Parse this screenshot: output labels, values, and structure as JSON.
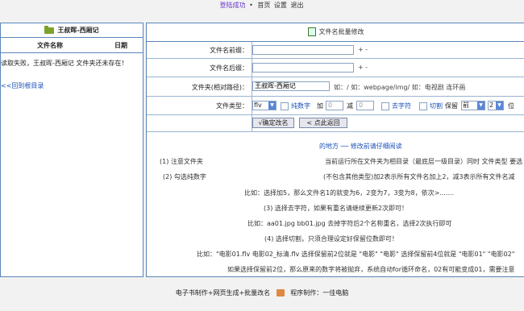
{
  "nav": {
    "login_status": "登陆成功",
    "dot": "•",
    "home": "首页",
    "settings": "设置",
    "logout": "退出"
  },
  "left": {
    "folder_title": "王叔晖-西厢记",
    "col_name": "文件名称",
    "col_date": "日期",
    "error_msg": "读取失败，王叔晖-西厢记 文件夹还未存在！",
    "back_link": "<<回到根目录"
  },
  "right": {
    "title": "文件名批量修改",
    "prefix_label": "文件名前缀：",
    "prefix_value": "",
    "prefix_hint": "+ -",
    "suffix_label": "文件名后缀：",
    "suffix_value": "",
    "suffix_hint": "+ -",
    "folder_label": "文件夹(相对路径)：",
    "folder_value": "王叔晖-西厢记",
    "folder_hint": "如：/ 如：webpage/img/ 如：电视剧 连环画",
    "type_label": "文件类型：",
    "type_value": "flv",
    "pure_number_label": "纯数字",
    "add_label": "加",
    "add_value": "0",
    "sub_label": "减",
    "sub_value": "0",
    "remove_chars_label": "去字符",
    "cut_label": "切割",
    "keep_label": "保留",
    "keep_select": "前",
    "keep_value": "2",
    "bits_label": "位",
    "confirm_button": "√确定改名",
    "back_button": "< 点此返回"
  },
  "info": {
    "heading_tail": "的地方 ── 修改前请仔细阅读",
    "line1": "(1) 注意文件夹",
    "line1b": "当前运行所在文件夹为相目录（最底层一级目录）同时 文件类型 要选",
    "line2": "(2) 勾选纯数字",
    "line2b": "(不包含其他类型)加2表示所有文件名加上2，减3表示所有文件名减",
    "line3": "比如：选择加5，那么文件名1的就变为6，2变为7，3变为8，依次>.......",
    "line4": "(3) 选择去字符，如果有重名请继续更新2次即可！",
    "line5": "比如：aa01.jpg bb01.jpg 去掉字符后2个名称重名，选择2次执行即可",
    "line6": "(4) 选择切割，只须合理设定好保留位数即可！",
    "line7": "比如：\"电影01.flv 电影02_标清.flv 选择保留前2位就是 \"电影\" \"电影\" 选择保留前4位就是 \"电影01\" \"电影02\"",
    "line8": "如果选择保留前2位，那么原来的数字将被抛弃，系统自动for循环命名，02有可能变成01，需要注意"
  },
  "footer": {
    "left_text": "电子书制作+网页生成+批量改名",
    "right_text": "程序制作：一佳电脑"
  }
}
